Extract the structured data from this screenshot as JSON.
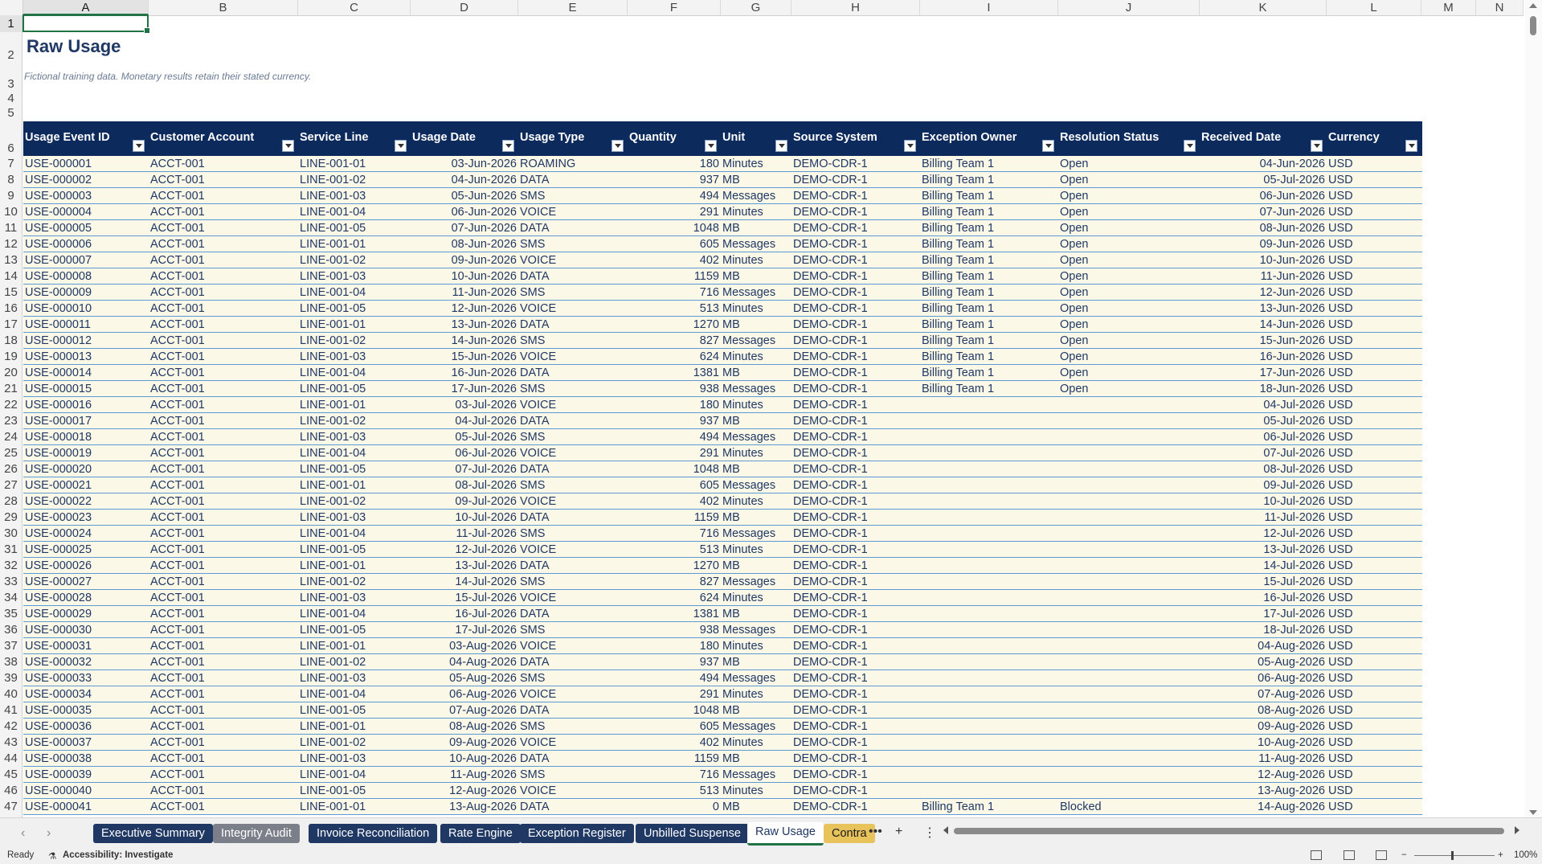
{
  "columns": [
    "A",
    "B",
    "C",
    "D",
    "E",
    "F",
    "G",
    "H",
    "I",
    "J",
    "K",
    "L",
    "M",
    "N"
  ],
  "selected_cell": "A1",
  "sheet": {
    "title": "Raw Usage",
    "subtitle": "Fictional training data. Monetary results retain their stated currency.",
    "headers": [
      "Usage Event ID",
      "Customer Account",
      "Service Line",
      "Usage Date",
      "Usage Type",
      "Quantity",
      "Unit",
      "Source System",
      "Exception Owner",
      "Resolution Status",
      "Received Date",
      "Currency"
    ],
    "rows": [
      [
        "7",
        "USE-000001",
        "ACCT-001",
        "LINE-001-01",
        "03-Jun-2026",
        "ROAMING",
        "180",
        "Minutes",
        "DEMO-CDR-1",
        "Billing Team 1",
        "Open",
        "04-Jun-2026",
        "USD"
      ],
      [
        "8",
        "USE-000002",
        "ACCT-001",
        "LINE-001-02",
        "04-Jun-2026",
        "DATA",
        "937",
        "MB",
        "DEMO-CDR-1",
        "Billing Team 1",
        "Open",
        "05-Jul-2026",
        "USD"
      ],
      [
        "9",
        "USE-000003",
        "ACCT-001",
        "LINE-001-03",
        "05-Jun-2026",
        "SMS",
        "494",
        "Messages",
        "DEMO-CDR-1",
        "Billing Team 1",
        "Open",
        "06-Jun-2026",
        "USD"
      ],
      [
        "10",
        "USE-000004",
        "ACCT-001",
        "LINE-001-04",
        "06-Jun-2026",
        "VOICE",
        "291",
        "Minutes",
        "DEMO-CDR-1",
        "Billing Team 1",
        "Open",
        "07-Jun-2026",
        "USD"
      ],
      [
        "11",
        "USE-000005",
        "ACCT-001",
        "LINE-001-05",
        "07-Jun-2026",
        "DATA",
        "1048",
        "MB",
        "DEMO-CDR-1",
        "Billing Team 1",
        "Open",
        "08-Jun-2026",
        "USD"
      ],
      [
        "12",
        "USE-000006",
        "ACCT-001",
        "LINE-001-01",
        "08-Jun-2026",
        "SMS",
        "605",
        "Messages",
        "DEMO-CDR-1",
        "Billing Team 1",
        "Open",
        "09-Jun-2026",
        "USD"
      ],
      [
        "13",
        "USE-000007",
        "ACCT-001",
        "LINE-001-02",
        "09-Jun-2026",
        "VOICE",
        "402",
        "Minutes",
        "DEMO-CDR-1",
        "Billing Team 1",
        "Open",
        "10-Jun-2026",
        "USD"
      ],
      [
        "14",
        "USE-000008",
        "ACCT-001",
        "LINE-001-03",
        "10-Jun-2026",
        "DATA",
        "1159",
        "MB",
        "DEMO-CDR-1",
        "Billing Team 1",
        "Open",
        "11-Jun-2026",
        "USD"
      ],
      [
        "15",
        "USE-000009",
        "ACCT-001",
        "LINE-001-04",
        "11-Jun-2026",
        "SMS",
        "716",
        "Messages",
        "DEMO-CDR-1",
        "Billing Team 1",
        "Open",
        "12-Jun-2026",
        "USD"
      ],
      [
        "16",
        "USE-000010",
        "ACCT-001",
        "LINE-001-05",
        "12-Jun-2026",
        "VOICE",
        "513",
        "Minutes",
        "DEMO-CDR-1",
        "Billing Team 1",
        "Open",
        "13-Jun-2026",
        "USD"
      ],
      [
        "17",
        "USE-000011",
        "ACCT-001",
        "LINE-001-01",
        "13-Jun-2026",
        "DATA",
        "1270",
        "MB",
        "DEMO-CDR-1",
        "Billing Team 1",
        "Open",
        "14-Jun-2026",
        "USD"
      ],
      [
        "18",
        "USE-000012",
        "ACCT-001",
        "LINE-001-02",
        "14-Jun-2026",
        "SMS",
        "827",
        "Messages",
        "DEMO-CDR-1",
        "Billing Team 1",
        "Open",
        "15-Jun-2026",
        "USD"
      ],
      [
        "19",
        "USE-000013",
        "ACCT-001",
        "LINE-001-03",
        "15-Jun-2026",
        "VOICE",
        "624",
        "Minutes",
        "DEMO-CDR-1",
        "Billing Team 1",
        "Open",
        "16-Jun-2026",
        "USD"
      ],
      [
        "20",
        "USE-000014",
        "ACCT-001",
        "LINE-001-04",
        "16-Jun-2026",
        "DATA",
        "1381",
        "MB",
        "DEMO-CDR-1",
        "Billing Team 1",
        "Open",
        "17-Jun-2026",
        "USD"
      ],
      [
        "21",
        "USE-000015",
        "ACCT-001",
        "LINE-001-05",
        "17-Jun-2026",
        "SMS",
        "938",
        "Messages",
        "DEMO-CDR-1",
        "Billing Team 1",
        "Open",
        "18-Jun-2026",
        "USD"
      ],
      [
        "22",
        "USE-000016",
        "ACCT-001",
        "LINE-001-01",
        "03-Jul-2026",
        "VOICE",
        "180",
        "Minutes",
        "DEMO-CDR-1",
        "",
        "",
        "04-Jul-2026",
        "USD"
      ],
      [
        "23",
        "USE-000017",
        "ACCT-001",
        "LINE-001-02",
        "04-Jul-2026",
        "DATA",
        "937",
        "MB",
        "DEMO-CDR-1",
        "",
        "",
        "05-Jul-2026",
        "USD"
      ],
      [
        "24",
        "USE-000018",
        "ACCT-001",
        "LINE-001-03",
        "05-Jul-2026",
        "SMS",
        "494",
        "Messages",
        "DEMO-CDR-1",
        "",
        "",
        "06-Jul-2026",
        "USD"
      ],
      [
        "25",
        "USE-000019",
        "ACCT-001",
        "LINE-001-04",
        "06-Jul-2026",
        "VOICE",
        "291",
        "Minutes",
        "DEMO-CDR-1",
        "",
        "",
        "07-Jul-2026",
        "USD"
      ],
      [
        "26",
        "USE-000020",
        "ACCT-001",
        "LINE-001-05",
        "07-Jul-2026",
        "DATA",
        "1048",
        "MB",
        "DEMO-CDR-1",
        "",
        "",
        "08-Jul-2026",
        "USD"
      ],
      [
        "27",
        "USE-000021",
        "ACCT-001",
        "LINE-001-01",
        "08-Jul-2026",
        "SMS",
        "605",
        "Messages",
        "DEMO-CDR-1",
        "",
        "",
        "09-Jul-2026",
        "USD"
      ],
      [
        "28",
        "USE-000022",
        "ACCT-001",
        "LINE-001-02",
        "09-Jul-2026",
        "VOICE",
        "402",
        "Minutes",
        "DEMO-CDR-1",
        "",
        "",
        "10-Jul-2026",
        "USD"
      ],
      [
        "29",
        "USE-000023",
        "ACCT-001",
        "LINE-001-03",
        "10-Jul-2026",
        "DATA",
        "1159",
        "MB",
        "DEMO-CDR-1",
        "",
        "",
        "11-Jul-2026",
        "USD"
      ],
      [
        "30",
        "USE-000024",
        "ACCT-001",
        "LINE-001-04",
        "11-Jul-2026",
        "SMS",
        "716",
        "Messages",
        "DEMO-CDR-1",
        "",
        "",
        "12-Jul-2026",
        "USD"
      ],
      [
        "31",
        "USE-000025",
        "ACCT-001",
        "LINE-001-05",
        "12-Jul-2026",
        "VOICE",
        "513",
        "Minutes",
        "DEMO-CDR-1",
        "",
        "",
        "13-Jul-2026",
        "USD"
      ],
      [
        "32",
        "USE-000026",
        "ACCT-001",
        "LINE-001-01",
        "13-Jul-2026",
        "DATA",
        "1270",
        "MB",
        "DEMO-CDR-1",
        "",
        "",
        "14-Jul-2026",
        "USD"
      ],
      [
        "33",
        "USE-000027",
        "ACCT-001",
        "LINE-001-02",
        "14-Jul-2026",
        "SMS",
        "827",
        "Messages",
        "DEMO-CDR-1",
        "",
        "",
        "15-Jul-2026",
        "USD"
      ],
      [
        "34",
        "USE-000028",
        "ACCT-001",
        "LINE-001-03",
        "15-Jul-2026",
        "VOICE",
        "624",
        "Minutes",
        "DEMO-CDR-1",
        "",
        "",
        "16-Jul-2026",
        "USD"
      ],
      [
        "35",
        "USE-000029",
        "ACCT-001",
        "LINE-001-04",
        "16-Jul-2026",
        "DATA",
        "1381",
        "MB",
        "DEMO-CDR-1",
        "",
        "",
        "17-Jul-2026",
        "USD"
      ],
      [
        "36",
        "USE-000030",
        "ACCT-001",
        "LINE-001-05",
        "17-Jul-2026",
        "SMS",
        "938",
        "Messages",
        "DEMO-CDR-1",
        "",
        "",
        "18-Jul-2026",
        "USD"
      ],
      [
        "37",
        "USE-000031",
        "ACCT-001",
        "LINE-001-01",
        "03-Aug-2026",
        "VOICE",
        "180",
        "Minutes",
        "DEMO-CDR-1",
        "",
        "",
        "04-Aug-2026",
        "USD"
      ],
      [
        "38",
        "USE-000032",
        "ACCT-001",
        "LINE-001-02",
        "04-Aug-2026",
        "DATA",
        "937",
        "MB",
        "DEMO-CDR-1",
        "",
        "",
        "05-Aug-2026",
        "USD"
      ],
      [
        "39",
        "USE-000033",
        "ACCT-001",
        "LINE-001-03",
        "05-Aug-2026",
        "SMS",
        "494",
        "Messages",
        "DEMO-CDR-1",
        "",
        "",
        "06-Aug-2026",
        "USD"
      ],
      [
        "40",
        "USE-000034",
        "ACCT-001",
        "LINE-001-04",
        "06-Aug-2026",
        "VOICE",
        "291",
        "Minutes",
        "DEMO-CDR-1",
        "",
        "",
        "07-Aug-2026",
        "USD"
      ],
      [
        "41",
        "USE-000035",
        "ACCT-001",
        "LINE-001-05",
        "07-Aug-2026",
        "DATA",
        "1048",
        "MB",
        "DEMO-CDR-1",
        "",
        "",
        "08-Aug-2026",
        "USD"
      ],
      [
        "42",
        "USE-000036",
        "ACCT-001",
        "LINE-001-01",
        "08-Aug-2026",
        "SMS",
        "605",
        "Messages",
        "DEMO-CDR-1",
        "",
        "",
        "09-Aug-2026",
        "USD"
      ],
      [
        "43",
        "USE-000037",
        "ACCT-001",
        "LINE-001-02",
        "09-Aug-2026",
        "VOICE",
        "402",
        "Minutes",
        "DEMO-CDR-1",
        "",
        "",
        "10-Aug-2026",
        "USD"
      ],
      [
        "44",
        "USE-000038",
        "ACCT-001",
        "LINE-001-03",
        "10-Aug-2026",
        "DATA",
        "1159",
        "MB",
        "DEMO-CDR-1",
        "",
        "",
        "11-Aug-2026",
        "USD"
      ],
      [
        "45",
        "USE-000039",
        "ACCT-001",
        "LINE-001-04",
        "11-Aug-2026",
        "SMS",
        "716",
        "Messages",
        "DEMO-CDR-1",
        "",
        "",
        "12-Aug-2026",
        "USD"
      ],
      [
        "46",
        "USE-000040",
        "ACCT-001",
        "LINE-001-05",
        "12-Aug-2026",
        "VOICE",
        "513",
        "Minutes",
        "DEMO-CDR-1",
        "",
        "",
        "13-Aug-2026",
        "USD"
      ],
      [
        "47",
        "USE-000041",
        "ACCT-001",
        "LINE-001-01",
        "13-Aug-2026",
        "DATA",
        "0",
        "MB",
        "DEMO-CDR-1",
        "Billing Team 1",
        "Blocked",
        "14-Aug-2026",
        "USD"
      ]
    ]
  },
  "tabs": [
    {
      "label": "Executive Summary",
      "style": "navy"
    },
    {
      "label": "Integrity Audit",
      "style": "gray"
    },
    {
      "label": "Invoice Reconciliation",
      "style": "navy"
    },
    {
      "label": "Rate Engine",
      "style": "navy"
    },
    {
      "label": "Exception Register",
      "style": "navy"
    },
    {
      "label": "Unbilled Suspense",
      "style": "navy"
    },
    {
      "label": "Raw Usage",
      "style": "active"
    },
    {
      "label": "Contra",
      "style": "gold"
    }
  ],
  "tabbar": {
    "more": "•••",
    "add": "+",
    "options": "⋮"
  },
  "status": {
    "ready": "Ready",
    "accessibility": "Accessibility: Investigate",
    "zoom": "100%",
    "zoom_minus": "−",
    "zoom_plus": "+"
  }
}
